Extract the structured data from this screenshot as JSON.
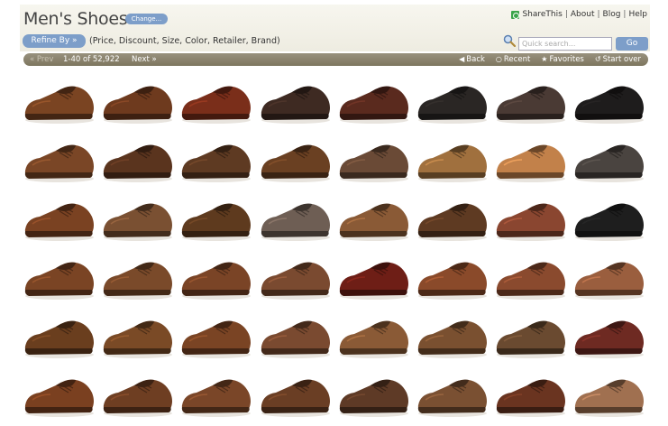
{
  "header": {
    "title": "Men's Shoes",
    "change_label": "Change...",
    "links": [
      "ShareThis",
      "About",
      "Blog",
      "Help"
    ],
    "refine_label": "Refine By »",
    "refine_options": "(Price, Discount, Size, Color, Retailer, Brand)",
    "search_placeholder": "Quick search...",
    "go_label": "Go"
  },
  "pager": {
    "prev": "« Prev",
    "count": "1-40 of 52,922",
    "next": "Next »",
    "nav": [
      {
        "icon": "back-arrow-icon",
        "label": "Back"
      },
      {
        "icon": "recent-clock-icon",
        "label": "Recent"
      },
      {
        "icon": "star-icon",
        "label": "Favorites"
      },
      {
        "icon": "start-over-icon",
        "label": "Start over"
      }
    ]
  },
  "colors": {
    "accent_blue": "#7d9ec9",
    "pager_bar": "#8a836e",
    "shareThis_green": "#3aa54a"
  },
  "grid": {
    "rows": 6,
    "cols": 8,
    "shoe_colors": [
      [
        "#7a4422",
        "#6e3a1e",
        "#7a2e1a",
        "#3e2a22",
        "#5a2a1e",
        "#2a2624",
        "#4a3a34",
        "#1e1c1c"
      ],
      [
        "#7a4626",
        "#5a341e",
        "#5e3a22",
        "#6a4022",
        "#6a4a36",
        "#a0703e",
        "#c2814a",
        "#4a4440"
      ],
      [
        "#7a4222",
        "#7a5032",
        "#5e3a1e",
        "#6e5e54",
        "#8a5a36",
        "#5e3a22",
        "#8a4630",
        "#1e1e1e"
      ],
      [
        "#7a4424",
        "#7a4a2a",
        "#7a4426",
        "#7a4a30",
        "#6e1e16",
        "#8a4a2a",
        "#8a4a2e",
        "#9a5e3e"
      ],
      [
        "#6a3e1e",
        "#7a4a26",
        "#7a4424",
        "#7a4a30",
        "#8a5a36",
        "#7a5030",
        "#6a4a30",
        "#6e2a22"
      ],
      [
        "#7a4020",
        "#6e3e22",
        "#7a4628",
        "#6a3e24",
        "#5e3a26",
        "#7a5032",
        "#6a3420",
        "#a07050"
      ]
    ]
  }
}
